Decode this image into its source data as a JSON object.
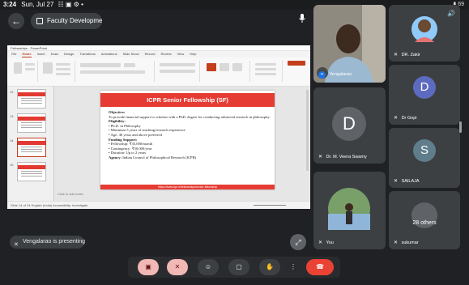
{
  "status_bar": {
    "time": "3:24",
    "date": "Sun, Jul 27",
    "sys_icons": "☷ ▣ ⚙ •",
    "battery": "▮ 69"
  },
  "meeting": {
    "title": "Faculty Developme"
  },
  "presentation": {
    "app_title": "Fellowships - PowerPoint",
    "ribbon_tabs": [
      "File",
      "Home",
      "Insert",
      "Draw",
      "Design",
      "Transitions",
      "Animations",
      "Slide Show",
      "Record",
      "Review",
      "View",
      "Help"
    ],
    "slide_numbers": [
      "12",
      "13",
      "14",
      "15"
    ],
    "slide": {
      "title": "ICPR Senior Fellowship (SF)",
      "objective_label": "Objective:",
      "objective_text": "To provide financial support to scholars with a PhD. degree for conducting advanced research in philosophy.",
      "eligibility_label": "Eligibility:",
      "eligibility_items": [
        "• Ph.D. in Philosophy",
        "• Minimum 5 years of teaching/research experience",
        "• Age: 40 years and above preferred"
      ],
      "funding_label": "Funding Support:",
      "funding_items": [
        "• Fellowship: ₹35,000/month",
        "• Contingency: ₹50,000/year",
        "• Duration: Up to 2 years"
      ],
      "agency_label": "Agency:",
      "agency_text": "Indian Council of Philosophical Research (ICPR)",
      "footer": "https://www.icpr.in/fellowships/senior-fellowship"
    },
    "notes_placeholder": "Click to add notes",
    "status_text": "Slide 14 of 24    English (India)    Accessibility: Investigate"
  },
  "presenting_label": "Vengalarao is presenting",
  "participants": [
    {
      "name": "Vengalarao",
      "kind": "photo",
      "speaking": true
    },
    {
      "name": "DR. Zakir",
      "kind": "photo"
    },
    {
      "name": "Dr Gopi",
      "kind": "letter",
      "letter": "D",
      "color": "#5c6bc0"
    },
    {
      "name": "Dr. M. Veera Swamy",
      "kind": "letter",
      "letter": "D",
      "color": "#5f6368"
    },
    {
      "name": "SAILAJA",
      "kind": "letter",
      "letter": "S",
      "color": "#607d8b"
    },
    {
      "name": "You",
      "kind": "photo"
    },
    {
      "name": "sukumar",
      "kind": "others",
      "others_label": "28 others"
    }
  ],
  "controls": {
    "icons": [
      "camera-off-icon",
      "mic-off-icon",
      "emoji-icon",
      "present-icon",
      "raise-hand-icon",
      "more-icon",
      "end-call-icon"
    ],
    "glyphs": [
      "▣",
      "✕",
      "☺",
      "▢",
      "✋",
      "⋮",
      "☎"
    ]
  }
}
